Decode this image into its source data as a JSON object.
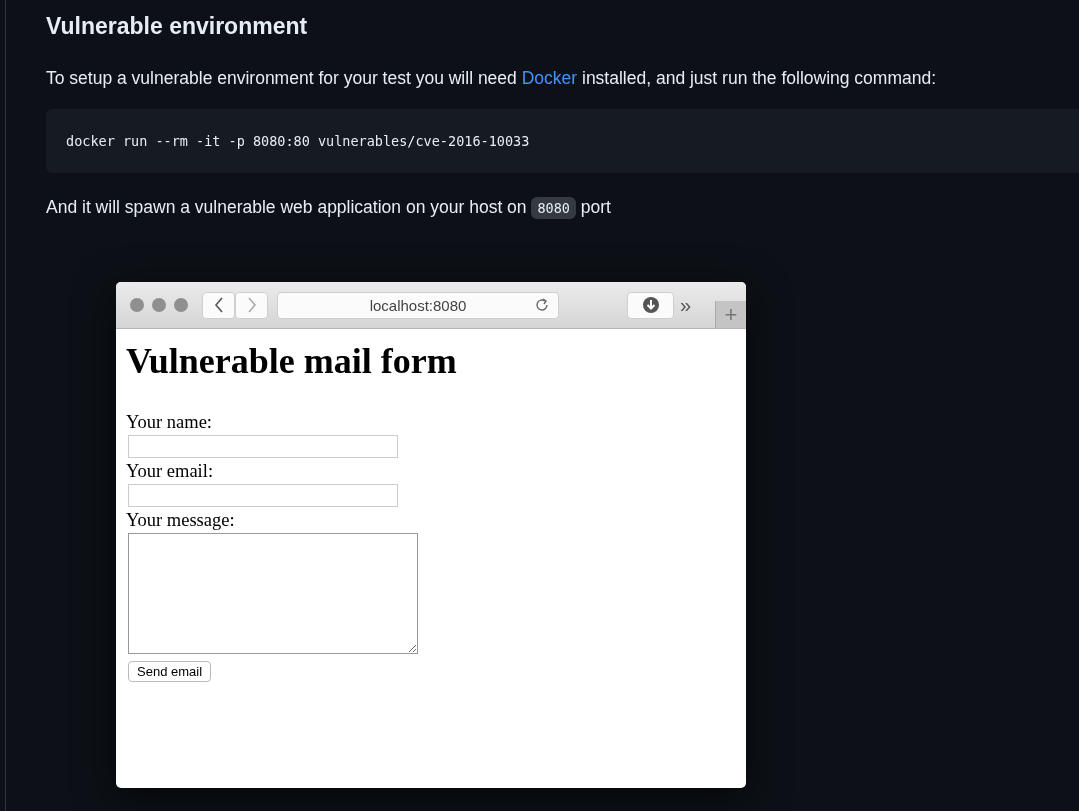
{
  "heading": "Vulnerable environment",
  "intro": {
    "before": "To setup a vulnerable environment for your test you will need ",
    "link": "Docker",
    "after": " installed, and just run the following command:"
  },
  "command": "docker run --rm -it -p 8080:80 vulnerables/cve-2016-10033",
  "spawn": {
    "before": "And it will spawn a vulnerable web application on your host on ",
    "code": "8080",
    "after": " port"
  },
  "browser": {
    "address": "localhost:8080",
    "overflow": "»",
    "new_tab": "+",
    "page": {
      "title": "Vulnerable mail form",
      "fields": [
        {
          "kind": "input",
          "label": "Your name:"
        },
        {
          "kind": "input",
          "label": "Your email:"
        },
        {
          "kind": "textarea",
          "label": "Your message:"
        }
      ],
      "submit": "Send email"
    }
  }
}
